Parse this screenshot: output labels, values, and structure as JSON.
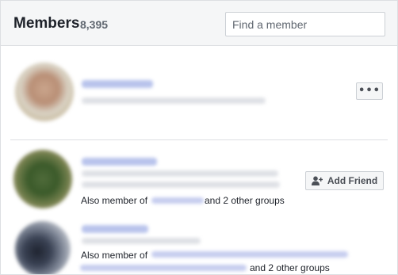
{
  "header": {
    "title": "Members",
    "count": "8,395",
    "search_placeholder": "Find a member"
  },
  "members": [
    {
      "more_label": "•••"
    },
    {
      "add_friend_label": "Add Friend",
      "also_member_prefix": "Also member of",
      "also_member_suffix": "and 2 other groups"
    },
    {
      "also_member_prefix": "Also member of",
      "also_member_suffix": "and 2 other groups"
    }
  ]
}
